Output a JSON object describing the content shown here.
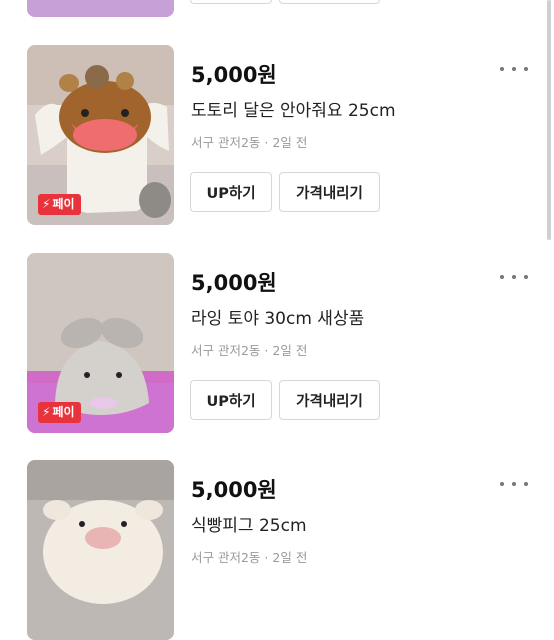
{
  "listings": [
    {
      "price": "5,000원",
      "title": "도토리 달은 안아줘요 25cm",
      "location": "서구 관저2동",
      "separator": "·",
      "time": "2일 전",
      "pay_badge": "페이",
      "up_label": "UP하기",
      "price_down_label": "가격내리기"
    },
    {
      "price": "5,000원",
      "title": "라잉 토야 30cm 새상품",
      "location": "서구 관저2동",
      "separator": "·",
      "time": "2일 전",
      "pay_badge": "페이",
      "up_label": "UP하기",
      "price_down_label": "가격내리기"
    },
    {
      "price": "5,000원",
      "title": "식빵피그 25cm",
      "location": "서구 관저2동",
      "separator": "·",
      "time": "2일 전"
    }
  ],
  "icons": {
    "more": "more-horizontal-icon",
    "bolt": "lightning-bolt-icon"
  },
  "colors": {
    "pay_badge": "#e8323c",
    "meta_text": "#9a9a9a",
    "button_border": "#d7d7d7"
  }
}
